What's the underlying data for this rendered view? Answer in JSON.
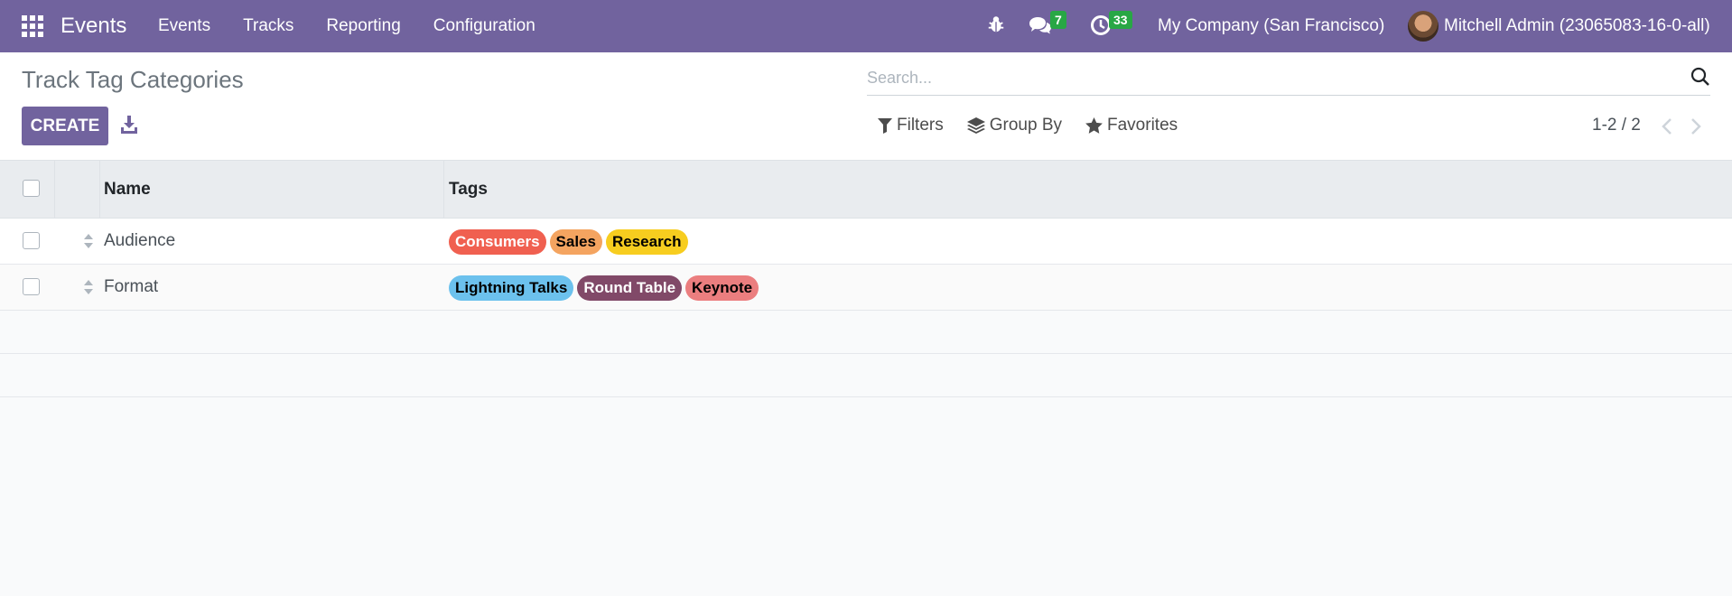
{
  "navbar": {
    "app_name": "Events",
    "menu": [
      "Events",
      "Tracks",
      "Reporting",
      "Configuration"
    ],
    "messages_count": "7",
    "activities_count": "33",
    "company": "My Company (San Francisco)",
    "user": "Mitchell Admin (23065083-16-0-all)",
    "colors": {
      "background": "#71639e",
      "badge": "#28a745"
    }
  },
  "control": {
    "title": "Track Tag Categories",
    "create_label": "CREATE",
    "search_placeholder": "Search...",
    "filters_label": "Filters",
    "groupby_label": "Group By",
    "favorites_label": "Favorites",
    "pager": "1-2 / 2"
  },
  "table": {
    "headers": {
      "name": "Name",
      "tags": "Tags"
    },
    "rows": [
      {
        "name": "Audience",
        "tags": [
          {
            "label": "Consumers",
            "bg": "#f06050",
            "fg": "#ffffff"
          },
          {
            "label": "Sales",
            "bg": "#f4a460",
            "fg": "#000000"
          },
          {
            "label": "Research",
            "bg": "#f7cd1f",
            "fg": "#000000"
          }
        ]
      },
      {
        "name": "Format",
        "tags": [
          {
            "label": "Lightning Talks",
            "bg": "#6cc1ed",
            "fg": "#000000"
          },
          {
            "label": "Round Table",
            "bg": "#814968",
            "fg": "#ffffff"
          },
          {
            "label": "Keynote",
            "bg": "#eb7e7f",
            "fg": "#000000"
          }
        ]
      }
    ]
  }
}
